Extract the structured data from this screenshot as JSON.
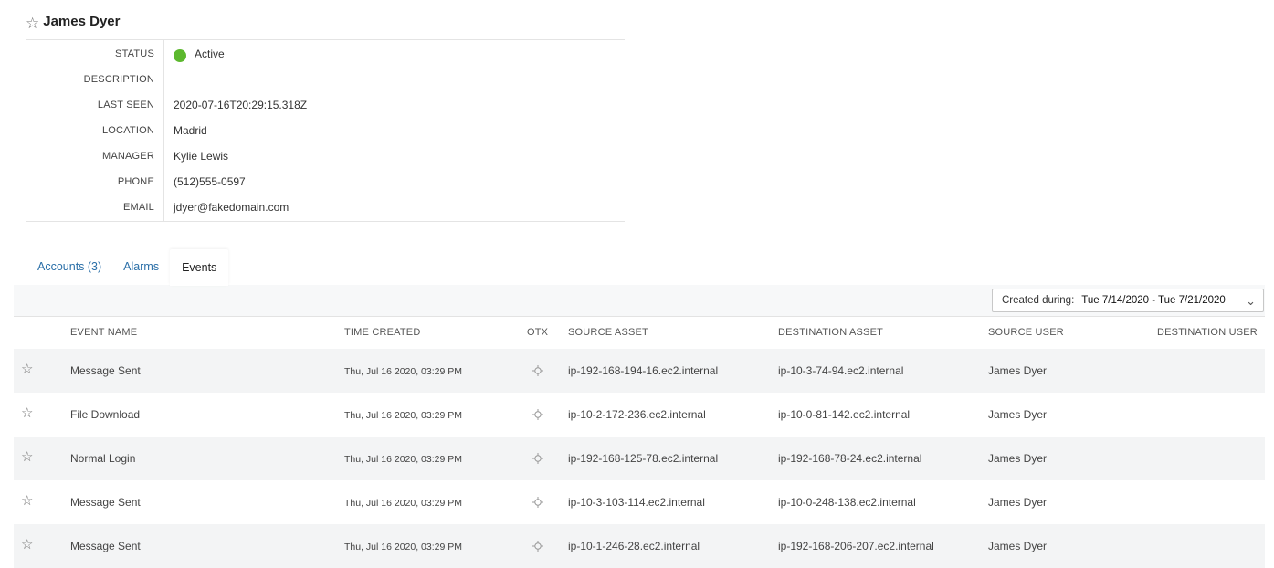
{
  "user": {
    "name": "James Dyer"
  },
  "details": [
    {
      "label": "STATUS",
      "value": "Active"
    },
    {
      "label": "DESCRIPTION",
      "value": ""
    },
    {
      "label": "LAST SEEN",
      "value": "2020-07-16T20:29:15.318Z"
    },
    {
      "label": "LOCATION",
      "value": "Madrid"
    },
    {
      "label": "MANAGER",
      "value": "Kylie Lewis"
    },
    {
      "label": "PHONE",
      "value": "(512)555-0597"
    },
    {
      "label": "EMAIL",
      "value": "jdyer@fakedomain.com"
    }
  ],
  "status_color": "#5cb82e",
  "link_color": "#2a6fa8",
  "tabs": [
    {
      "label": "Accounts (3)"
    },
    {
      "label": "Alarms"
    },
    {
      "label": "Events",
      "active": true
    }
  ],
  "filter": {
    "label": "Created during:",
    "value": "Tue 7/14/2020 - Tue 7/21/2020",
    "icon": "chevron-down-icon"
  },
  "table": {
    "columns": [
      "EVENT NAME",
      "TIME CREATED",
      "OTX",
      "SOURCE ASSET",
      "DESTINATION ASSET",
      "SOURCE USER",
      "DESTINATION USER"
    ],
    "rows": [
      {
        "event": "Message Sent",
        "time": "Thu, Jul 16 2020, 03:29 PM",
        "source_asset": "ip-192-168-194-16.ec2.internal",
        "dest_asset": "ip-10-3-74-94.ec2.internal",
        "source_user": "James Dyer",
        "dest_user": ""
      },
      {
        "event": "File Download",
        "time": "Thu, Jul 16 2020, 03:29 PM",
        "source_asset": "ip-10-2-172-236.ec2.internal",
        "dest_asset": "ip-10-0-81-142.ec2.internal",
        "source_user": "James Dyer",
        "dest_user": ""
      },
      {
        "event": "Normal Login",
        "time": "Thu, Jul 16 2020, 03:29 PM",
        "source_asset": "ip-192-168-125-78.ec2.internal",
        "dest_asset": "ip-192-168-78-24.ec2.internal",
        "source_user": "James Dyer",
        "dest_user": ""
      },
      {
        "event": "Message Sent",
        "time": "Thu, Jul 16 2020, 03:29 PM",
        "source_asset": "ip-10-3-103-114.ec2.internal",
        "dest_asset": "ip-10-0-248-138.ec2.internal",
        "source_user": "James Dyer",
        "dest_user": ""
      },
      {
        "event": "Message Sent",
        "time": "Thu, Jul 16 2020, 03:29 PM",
        "source_asset": "ip-10-1-246-28.ec2.internal",
        "dest_asset": "ip-192-168-206-207.ec2.internal",
        "source_user": "James Dyer",
        "dest_user": ""
      }
    ]
  }
}
